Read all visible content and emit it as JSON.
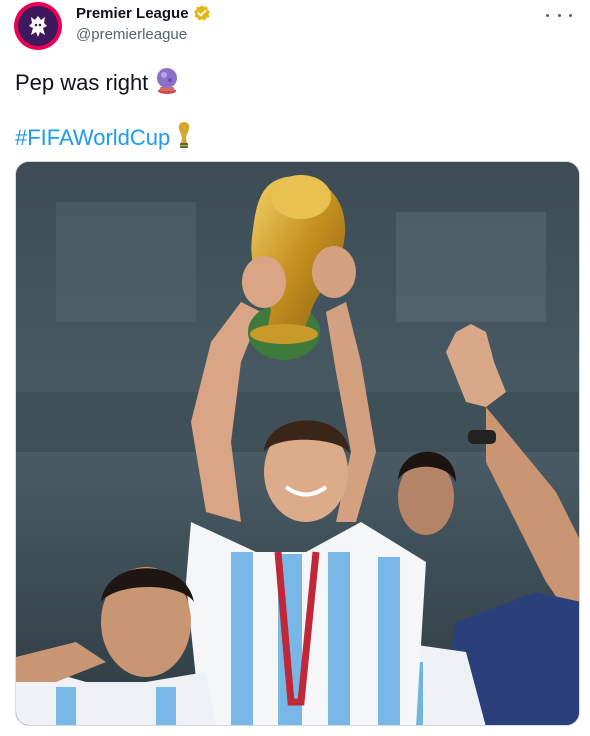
{
  "tweet": {
    "display_name": "Premier League",
    "handle": "@premierleague",
    "verified": true,
    "text_line1": "Pep was right",
    "text_line1_emoji": "crystal-ball-icon",
    "hashtag": "#FIFAWorldCup",
    "hashtag_emoji": "trophy-icon",
    "media": {
      "type": "photo",
      "subject": "player lifting World Cup trophy"
    }
  },
  "colors": {
    "link": "#1d9bf0",
    "text": "#0f1419",
    "secondary": "#536471",
    "avatar_bg": "#e90052",
    "verified_badge": "#e2b719"
  }
}
